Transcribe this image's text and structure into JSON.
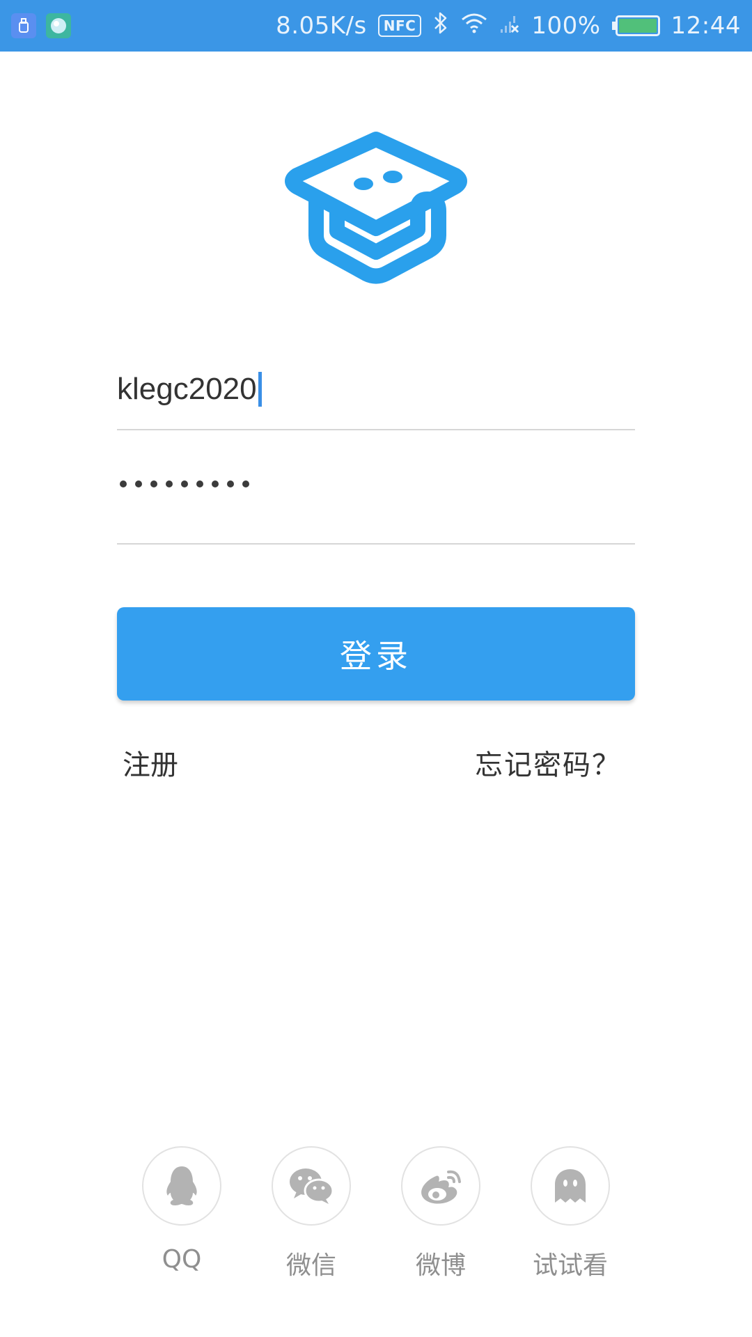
{
  "status_bar": {
    "network_speed": "8.05K/s",
    "nfc": "NFC",
    "battery_percent": "100%",
    "battery_level": 1.0,
    "time": "12:44",
    "icons": [
      "usb-notification-icon",
      "app-notification-icon",
      "bluetooth-icon",
      "wifi-icon",
      "signal-icon",
      "battery-icon"
    ]
  },
  "login": {
    "username_value": "klegc2020",
    "password_mask_count": 9,
    "login_button": "登录",
    "register_link": "注册",
    "forgot_link": "忘记密码？"
  },
  "social": {
    "items": [
      {
        "label": "QQ",
        "icon": "qq-penguin-icon"
      },
      {
        "label": "微信",
        "icon": "wechat-icon"
      },
      {
        "label": "微博",
        "icon": "weibo-icon"
      },
      {
        "label": "试试看",
        "icon": "ghost-icon"
      }
    ]
  },
  "colors": {
    "status_bar": "#3b96e6",
    "primary": "#349fef",
    "social_icon": "#b3b3b3"
  }
}
